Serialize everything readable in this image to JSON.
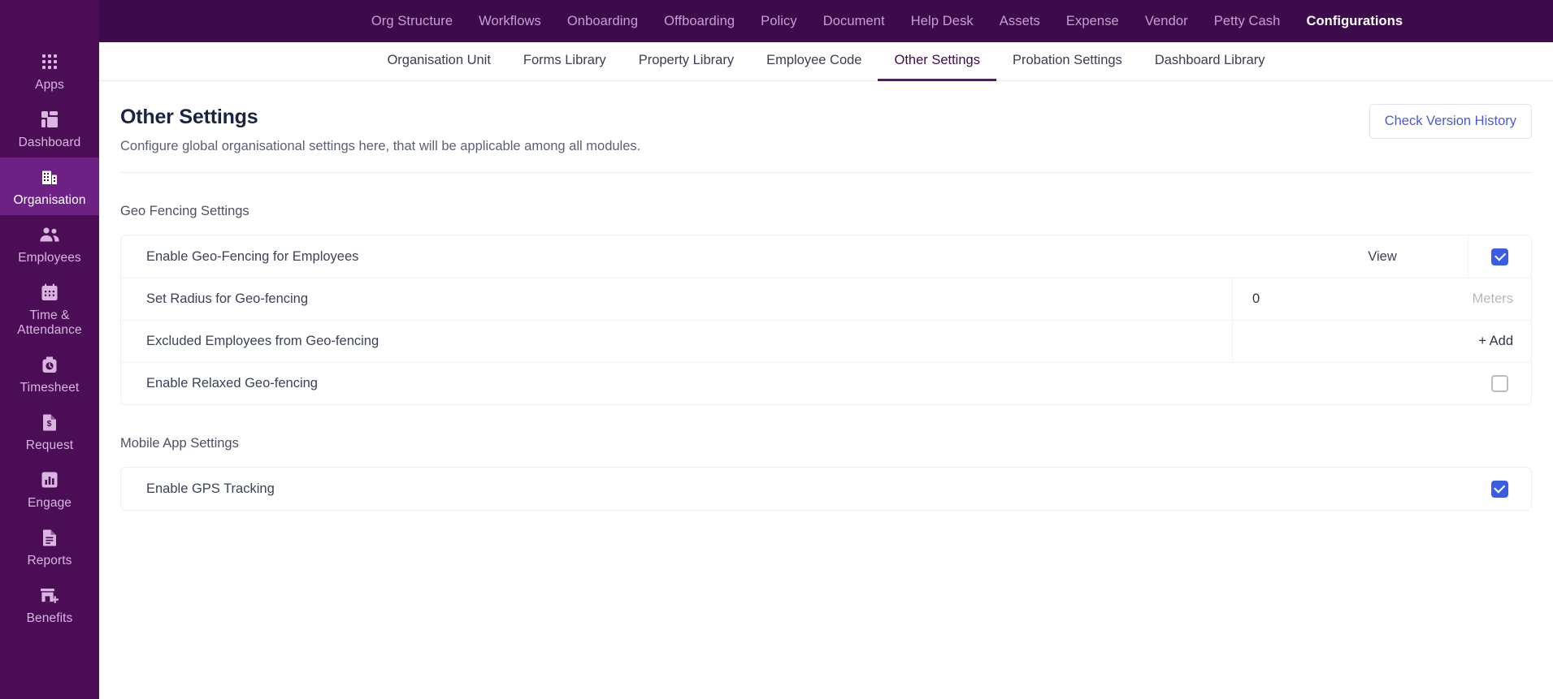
{
  "colors": {
    "topbar_bg": "#3d0b4b",
    "rail_bg": "#4a0d56",
    "rail_active_bg": "#6d2185",
    "accent_blue": "#3b5ce4",
    "tab_active": "#5b1270"
  },
  "rail": {
    "items": [
      {
        "label": "Apps",
        "icon": "apps-grid-icon",
        "active": false
      },
      {
        "label": "Dashboard",
        "icon": "dashboard-icon",
        "active": false
      },
      {
        "label": "Organisation",
        "icon": "building-icon",
        "active": true
      },
      {
        "label": "Employees",
        "icon": "people-icon",
        "active": false
      },
      {
        "label": "Time &\nAttendance",
        "icon": "calendar-icon",
        "active": false
      },
      {
        "label": "Timesheet",
        "icon": "clock-bag-icon",
        "active": false
      },
      {
        "label": "Request",
        "icon": "dollar-document-icon",
        "active": false
      },
      {
        "label": "Engage",
        "icon": "bar-chart-icon",
        "active": false
      },
      {
        "label": "Reports",
        "icon": "report-document-icon",
        "active": false
      },
      {
        "label": "Benefits",
        "icon": "store-plus-icon",
        "active": false
      }
    ]
  },
  "topnav": {
    "items": [
      {
        "label": "Org Structure",
        "active": false
      },
      {
        "label": "Workflows",
        "active": false
      },
      {
        "label": "Onboarding",
        "active": false
      },
      {
        "label": "Offboarding",
        "active": false
      },
      {
        "label": "Policy",
        "active": false
      },
      {
        "label": "Document",
        "active": false
      },
      {
        "label": "Help Desk",
        "active": false
      },
      {
        "label": "Assets",
        "active": false
      },
      {
        "label": "Expense",
        "active": false
      },
      {
        "label": "Vendor",
        "active": false
      },
      {
        "label": "Petty Cash",
        "active": false
      },
      {
        "label": "Configurations",
        "active": true
      }
    ]
  },
  "subtabs": {
    "items": [
      {
        "label": "Organisation Unit",
        "active": false
      },
      {
        "label": "Forms Library",
        "active": false
      },
      {
        "label": "Property Library",
        "active": false
      },
      {
        "label": "Employee Code",
        "active": false
      },
      {
        "label": "Other Settings",
        "active": true
      },
      {
        "label": "Probation Settings",
        "active": false
      },
      {
        "label": "Dashboard Library",
        "active": false
      }
    ]
  },
  "page": {
    "title": "Other Settings",
    "subtitle": "Configure global organisational settings here, that will be applicable among all modules.",
    "version_button": "Check Version History"
  },
  "sections": [
    {
      "title": "Geo Fencing Settings",
      "rows": [
        {
          "label": "Enable Geo-Fencing for Employees",
          "type": "view-check",
          "view_label": "View",
          "checked": true
        },
        {
          "label": "Set Radius for Geo-fencing",
          "type": "input",
          "value": "0",
          "suffix": "Meters"
        },
        {
          "label": "Excluded Employees from Geo-fencing",
          "type": "add",
          "add_label": "+ Add"
        },
        {
          "label": "Enable Relaxed Geo-fencing",
          "type": "check",
          "checked": false
        }
      ]
    },
    {
      "title": "Mobile App Settings",
      "rows": [
        {
          "label": "Enable GPS Tracking",
          "type": "check",
          "checked": true
        }
      ]
    }
  ]
}
